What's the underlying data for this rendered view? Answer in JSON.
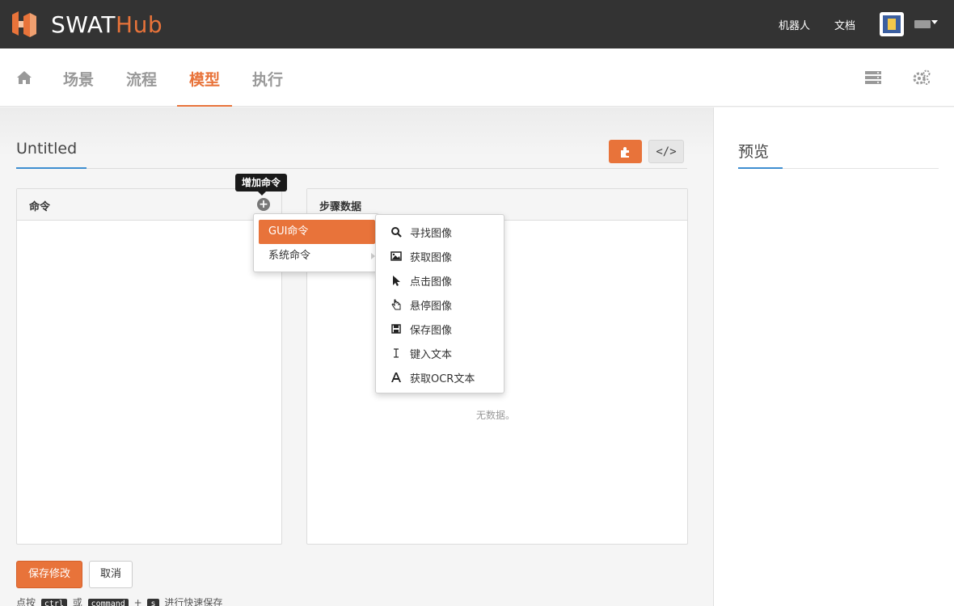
{
  "app": {
    "brand_swat": "SWAT",
    "brand_hub": "Hub",
    "top_links": [
      "机器人",
      "文档"
    ],
    "colors": {
      "accent": "#e8733a",
      "topbar": "#333333",
      "link_accent": "#3e8ed0"
    }
  },
  "nav": {
    "home_icon": "home-icon",
    "tabs": [
      {
        "label": "场景",
        "active": false
      },
      {
        "label": "流程",
        "active": false
      },
      {
        "label": "模型",
        "active": true
      },
      {
        "label": "执行",
        "active": false
      }
    ],
    "right_icons": [
      "server-icon",
      "gears-icon"
    ]
  },
  "editor": {
    "title": "Untitled",
    "code_button": "</>",
    "commands_panel": {
      "title": "命令",
      "add_tooltip": "增加命令"
    },
    "step_panel": {
      "title": "步骤数据",
      "empty": "无数据。"
    },
    "save_label": "保存修改",
    "cancel_label": "取消",
    "hint_prefix": "点按",
    "hint_key1": "ctrl",
    "hint_or": "或",
    "hint_key2": "command",
    "hint_plus": "+",
    "hint_key3": "s",
    "hint_suffix": "进行快速保存"
  },
  "preview": {
    "title": "预览"
  },
  "context_menu": {
    "items": [
      {
        "label": "GUI命令",
        "active": true
      },
      {
        "label": "系统命令",
        "active": false
      }
    ],
    "submenu": [
      {
        "label": "寻找图像",
        "icon": "search-icon"
      },
      {
        "label": "获取图像",
        "icon": "image-icon"
      },
      {
        "label": "点击图像",
        "icon": "cursor-icon"
      },
      {
        "label": "悬停图像",
        "icon": "hand-icon"
      },
      {
        "label": "保存图像",
        "icon": "floppy-icon"
      },
      {
        "label": "键入文本",
        "icon": "text-cursor-icon"
      },
      {
        "label": "获取OCR文本",
        "icon": "font-icon"
      }
    ]
  }
}
